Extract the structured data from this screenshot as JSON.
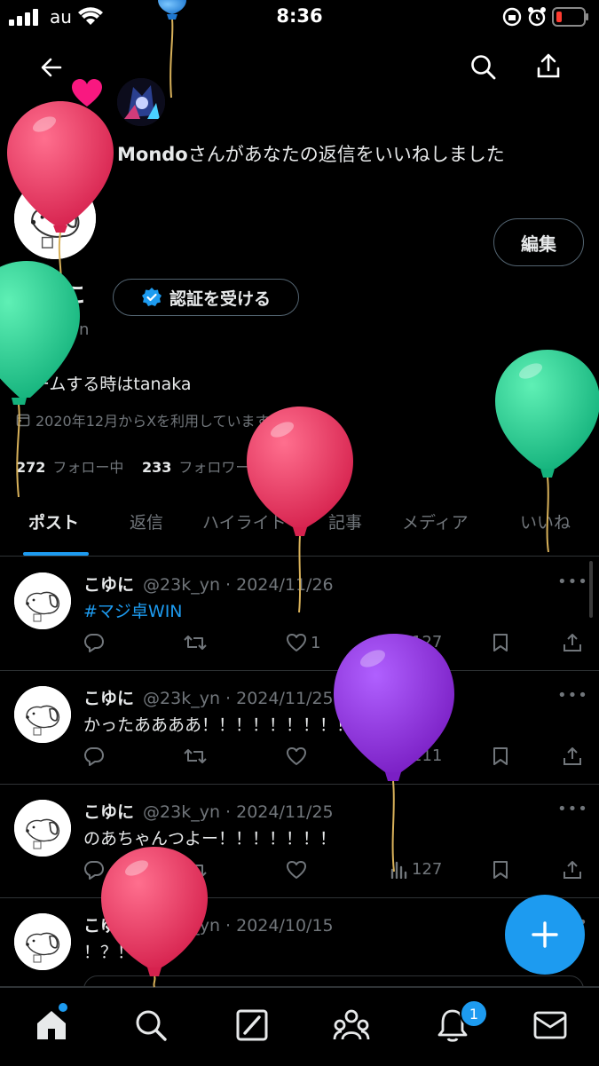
{
  "status_bar": {
    "carrier": "au",
    "time": "8:36"
  },
  "notification": {
    "user": "Mondo",
    "message": "さんがあなたの返信をいいねしました"
  },
  "profile": {
    "name": "こゆに",
    "handle": "@23k_yn",
    "verify_label": "認証を受ける",
    "edit_label": "編集",
    "bio": "ゲームする時はtanaka",
    "joined": "2020年12月からXを利用しています",
    "following_count": "272",
    "following_label": "フォロー中",
    "followers_count": "233",
    "followers_label": "フォロワー"
  },
  "tabs": [
    "ポスト",
    "返信",
    "ハイライト",
    "記事",
    "メディア",
    "いいね"
  ],
  "posts": [
    {
      "name": "こゆに",
      "handle": "@23k_yn",
      "date": "2024/11/26",
      "text": "#マジ卓WIN",
      "likes": "1",
      "views": "127"
    },
    {
      "name": "こゆに",
      "handle": "@23k_yn",
      "date": "2024/11/25",
      "text": "かったああああ！！！！！！！！！！",
      "likes": "",
      "views": "111"
    },
    {
      "name": "こゆに",
      "handle": "@23k_yn",
      "date": "2024/11/25",
      "text": "のあちゃんつよー！！！！！！！",
      "likes": "",
      "views": "127"
    },
    {
      "name": "こゆに",
      "handle": "@23k_yn",
      "date": "2024/10/15",
      "text": "！？！",
      "likes": "",
      "views": ""
    }
  ],
  "notifications_badge": "1",
  "colors": {
    "accent": "#1d9bf0",
    "background": "#000000",
    "text": "#e7e9ea",
    "muted": "#71767b",
    "balloon_red": "#e0325a",
    "balloon_green": "#2ec98f",
    "balloon_purple": "#8b2fd0"
  },
  "icons": [
    "back-arrow-icon",
    "search-icon",
    "share-icon",
    "heart-icon",
    "verified-badge-icon",
    "calendar-icon",
    "reply-icon",
    "retweet-icon",
    "like-icon",
    "views-icon",
    "bookmark-icon",
    "home-icon",
    "compose-icon",
    "communities-icon",
    "bell-icon",
    "mail-icon",
    "plus-icon",
    "balloon-icon"
  ]
}
